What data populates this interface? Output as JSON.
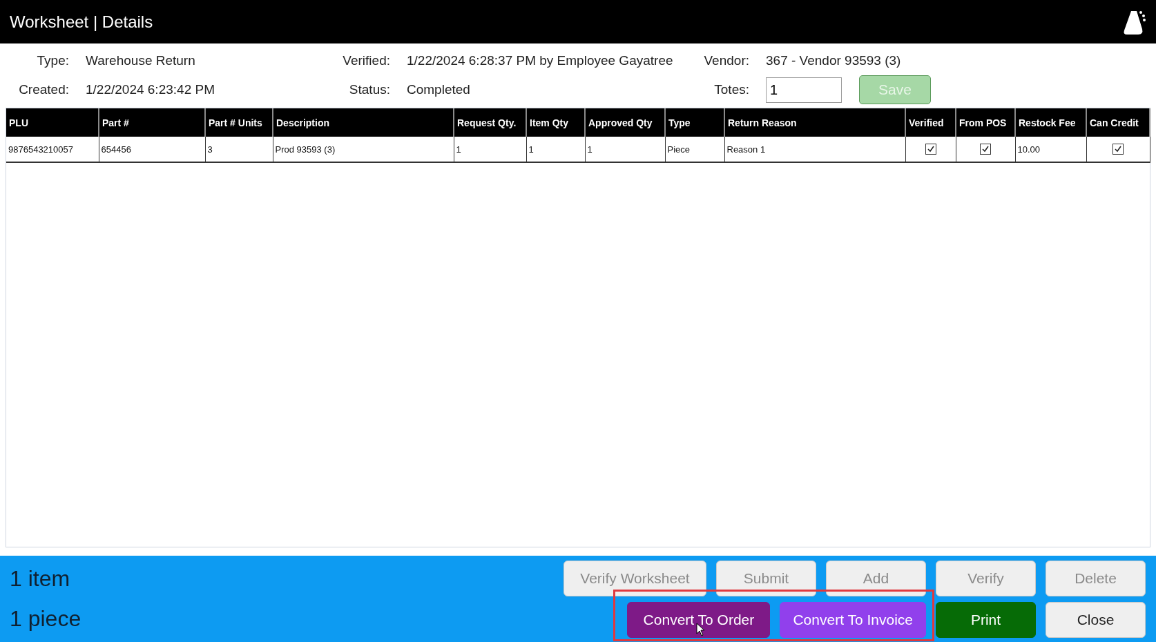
{
  "window": {
    "title": "Worksheet | Details"
  },
  "info": {
    "type_label": "Type:",
    "type": "Warehouse Return",
    "verified_label": "Verified:",
    "verified": "1/22/2024 6:28:37 PM by Employee Gayatree",
    "vendor_label": "Vendor:",
    "vendor": "367 - Vendor 93593 (3)",
    "created_label": "Created:",
    "created": "1/22/2024 6:23:42 PM",
    "status_label": "Status:",
    "status": "Completed",
    "totes_label": "Totes:",
    "totes": "1",
    "save": {
      "label": "Save",
      "disabled": true
    }
  },
  "table": {
    "columns": [
      {
        "label": "PLU",
        "kind": "text"
      },
      {
        "label": "Part #",
        "kind": "text"
      },
      {
        "label": "Part # Units",
        "kind": "text"
      },
      {
        "label": "Description",
        "kind": "text"
      },
      {
        "label": "Request Qty.",
        "kind": "text"
      },
      {
        "label": "Item Qty",
        "kind": "text"
      },
      {
        "label": "Approved Qty",
        "kind": "text"
      },
      {
        "label": "Type",
        "kind": "text"
      },
      {
        "label": "Return Reason",
        "kind": "text"
      },
      {
        "label": "Verified",
        "kind": "check"
      },
      {
        "label": "From POS",
        "kind": "check"
      },
      {
        "label": "Restock Fee",
        "kind": "text"
      },
      {
        "label": "Can Credit",
        "kind": "check"
      }
    ],
    "rows": [
      {
        "cells": [
          "9876543210057",
          "654456",
          "3",
          "Prod 93593 (3)",
          "1",
          "1",
          "1",
          "Piece",
          "Reason 1",
          true,
          true,
          "10.00",
          true
        ]
      }
    ]
  },
  "footer": {
    "item_count": "1 item",
    "piece_count": "1 piece",
    "buttons_top": [
      {
        "label": "Verify Worksheet",
        "disabled": true,
        "color": "#efefef"
      },
      {
        "label": "Submit",
        "disabled": true,
        "color": "#efefef"
      },
      {
        "label": "Add",
        "disabled": true,
        "color": "#efefef"
      },
      {
        "label": "Verify",
        "disabled": true,
        "color": "#efefef"
      },
      {
        "label": "Delete",
        "disabled": true,
        "color": "#efefef"
      }
    ],
    "buttons_bottom": [
      {
        "label": "Convert To Order",
        "disabled": false,
        "color": "#7e1a87"
      },
      {
        "label": "Convert To Invoice",
        "disabled": false,
        "color": "#9140ec"
      },
      {
        "label": "Print",
        "disabled": false,
        "color": "#066b06"
      },
      {
        "label": "Close",
        "disabled": false,
        "color": "#efefef"
      }
    ],
    "highlighted_group": true
  }
}
